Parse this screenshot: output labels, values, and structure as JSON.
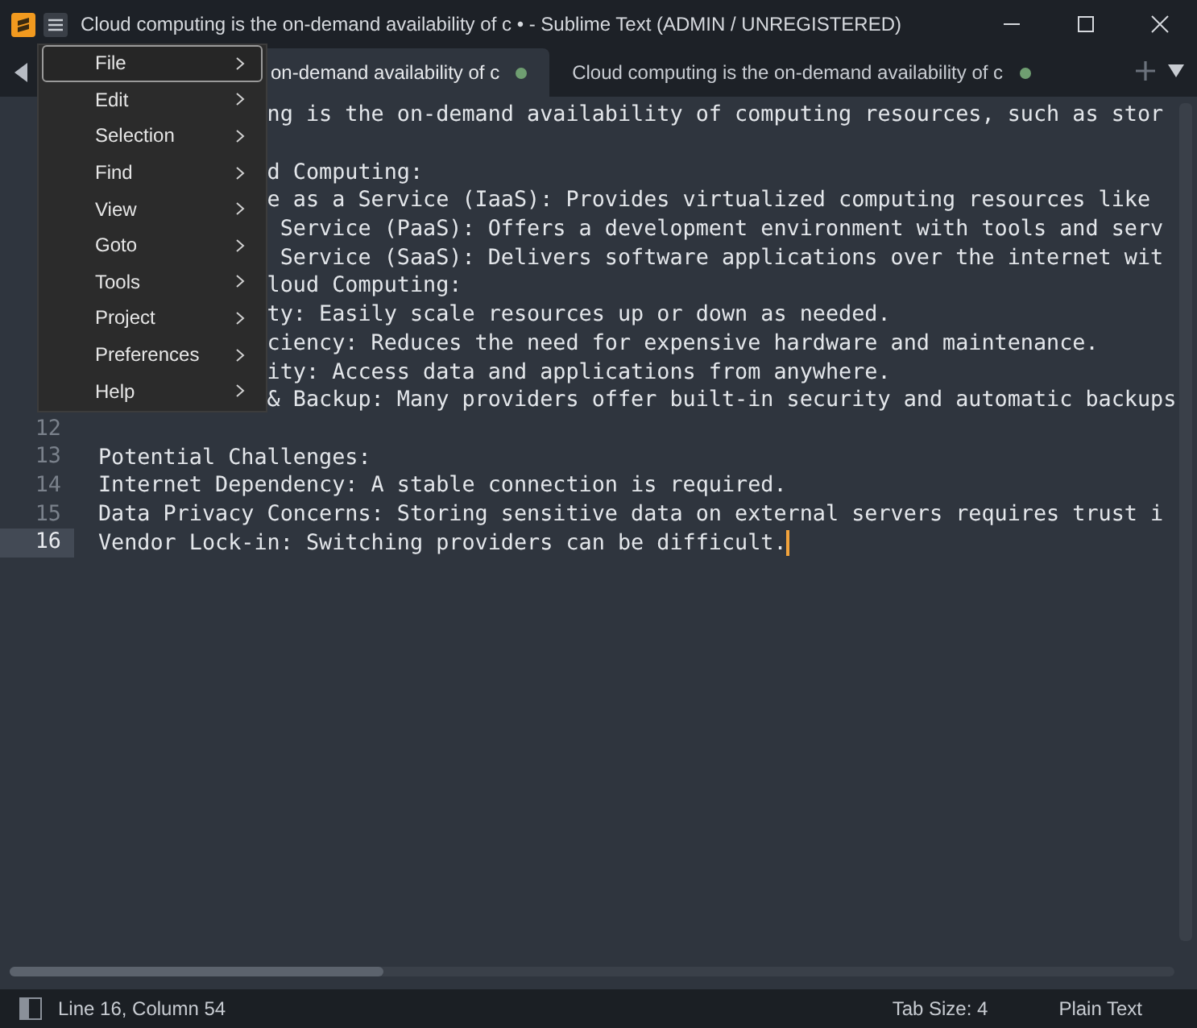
{
  "window": {
    "title": "Cloud computing is the on-demand availability of c • - Sublime Text (ADMIN / UNREGISTERED)"
  },
  "tabs": [
    {
      "label": "on-demand availability of c",
      "selected": true,
      "modified": true
    },
    {
      "label": "Cloud computing is the on-demand availability of c",
      "selected": false,
      "modified": true
    }
  ],
  "editor": {
    "lines": [
      {
        "kind": "covered",
        "text": "ng is the on-demand availability of computing resources, such as stor"
      },
      {
        "kind": "blank"
      },
      {
        "kind": "covered",
        "text": "d Computing:"
      },
      {
        "kind": "covered",
        "text": "e as a Service (IaaS): Provides virtualized computing resources like"
      },
      {
        "kind": "covered",
        "text": " Service (PaaS): Offers a development environment with tools and serv"
      },
      {
        "kind": "covered",
        "text": " Service (SaaS): Delivers software applications over the internet wit"
      },
      {
        "kind": "covered",
        "text": "loud Computing:"
      },
      {
        "kind": "covered",
        "text": "ty: Easily scale resources up or down as needed."
      },
      {
        "kind": "covered",
        "text": "ciency: Reduces the need for expensive hardware and maintenance."
      },
      {
        "kind": "covered",
        "text": "ity: Access data and applications from anywhere."
      },
      {
        "kind": "covered",
        "text": "& Backup: Many providers offer built-in security and automatic backups"
      },
      {
        "kind": "full",
        "number": "12",
        "current": false
      },
      {
        "kind": "full",
        "number": "13",
        "text": "Potential Challenges:",
        "current": false
      },
      {
        "kind": "full",
        "number": "14",
        "text": "Internet Dependency: A stable connection is required.",
        "current": false
      },
      {
        "kind": "full",
        "number": "15",
        "text": "Data Privacy Concerns: Storing sensitive data on external servers requires trust i",
        "current": false
      },
      {
        "kind": "full",
        "number": "16",
        "text": "Vendor Lock-in: Switching providers can be difficult.",
        "current": true,
        "caret": true
      }
    ]
  },
  "menu": {
    "items": [
      {
        "label": "File",
        "selected": true
      },
      {
        "label": "Edit",
        "selected": false
      },
      {
        "label": "Selection",
        "selected": false
      },
      {
        "label": "Find",
        "selected": false
      },
      {
        "label": "View",
        "selected": false
      },
      {
        "label": "Goto",
        "selected": false
      },
      {
        "label": "Tools",
        "selected": false
      },
      {
        "label": "Project",
        "selected": false
      },
      {
        "label": "Preferences",
        "selected": false
      },
      {
        "label": "Help",
        "selected": false
      }
    ]
  },
  "status_bar": {
    "position": "Line 16, Column 54",
    "tab_size": "Tab Size: 4",
    "syntax": "Plain Text"
  }
}
